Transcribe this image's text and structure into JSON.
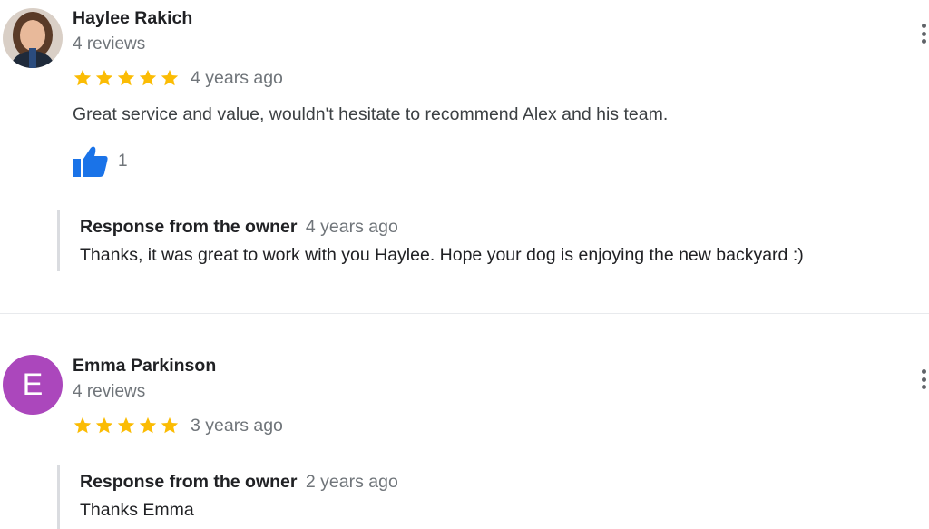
{
  "colors": {
    "star": "#fbbc04",
    "thumb": "#1a73e8",
    "avatar_emma": "#ab47bc"
  },
  "reviews": [
    {
      "reviewer_name": "Haylee Rakich",
      "review_count": "4 reviews",
      "rating": 5,
      "time": "4 years ago",
      "text": "Great service and value, wouldn't hesitate to recommend Alex and his team.",
      "likes": "1",
      "owner_response": {
        "label": "Response from the owner",
        "time": "4 years ago",
        "text": "Thanks, it was great to work with you Haylee. Hope your dog is enjoying the new backyard :)"
      }
    },
    {
      "reviewer_name": "Emma Parkinson",
      "avatar_letter": "E",
      "review_count": "4 reviews",
      "rating": 5,
      "time": "3 years ago",
      "owner_response": {
        "label": "Response from the owner",
        "time": "2 years ago",
        "text": "Thanks Emma"
      }
    }
  ],
  "icons": {
    "menu": "more-vert-icon",
    "like": "thumb-up-icon",
    "star": "star-icon"
  }
}
